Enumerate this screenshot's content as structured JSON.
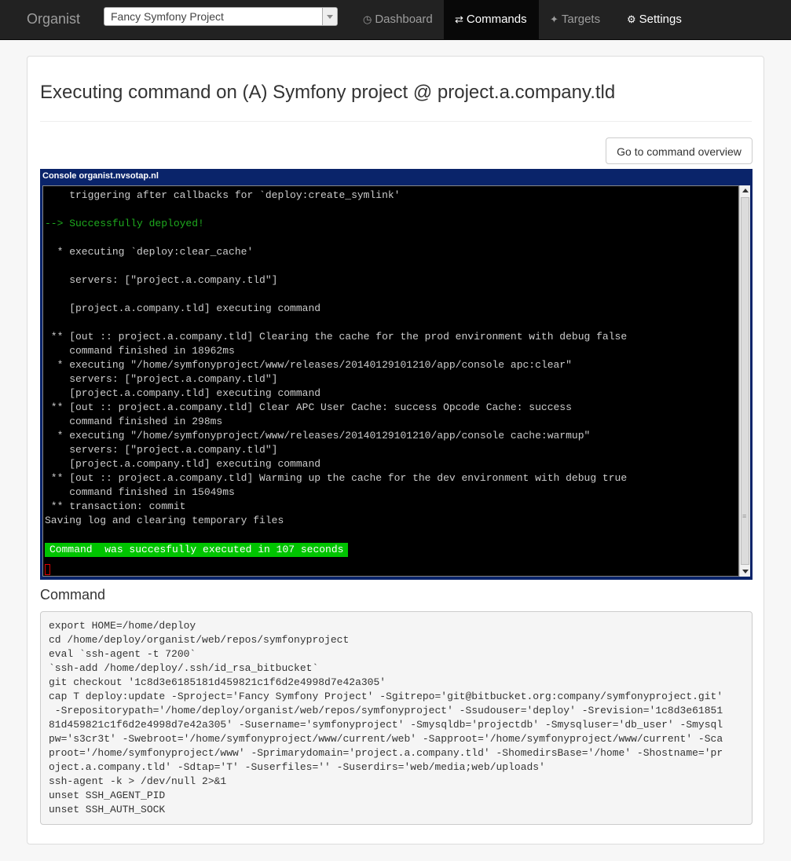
{
  "navbar": {
    "brand": "Organist",
    "project_select": "Fancy Symfony Project",
    "items": [
      {
        "label": "Dashboard",
        "icon": "dashboard-icon"
      },
      {
        "label": "Commands",
        "icon": "commands-icon"
      },
      {
        "label": "Targets",
        "icon": "targets-icon"
      },
      {
        "label": "Settings",
        "icon": "gear-icon"
      }
    ]
  },
  "page": {
    "title": "Executing command on (A) Symfony project @ project.a.company.tld",
    "overview_button": "Go to command overview"
  },
  "console": {
    "title": "Console organist.nvsotap.nl",
    "lines": [
      "    triggering after callbacks for `deploy:create_symlink'",
      "",
      "--> Successfully deployed!",
      "",
      "  * executing `deploy:clear_cache'",
      "",
      "    servers: [\"project.a.company.tld\"]",
      "",
      "    [project.a.company.tld] executing command",
      "",
      " ** [out :: project.a.company.tld] Clearing the cache for the prod environment with debug false",
      "    command finished in 18962ms",
      "  * executing \"/home/symfonyproject/www/releases/20140129101210/app/console apc:clear\"",
      "    servers: [\"project.a.company.tld\"]",
      "    [project.a.company.tld] executing command",
      " ** [out :: project.a.company.tld] Clear APC User Cache: success Opcode Cache: success",
      "    command finished in 298ms",
      "  * executing \"/home/symfonyproject/www/releases/20140129101210/app/console cache:warmup\"",
      "    servers: [\"project.a.company.tld\"]",
      "    [project.a.company.tld] executing command",
      " ** [out :: project.a.company.tld] Warming up the cache for the dev environment with debug true",
      "    command finished in 15049ms",
      " ** transaction: commit",
      "Saving log and clearing temporary files",
      "",
      "Command  was succesfully executed in 107 seconds"
    ],
    "success_color": "#00c400",
    "deployed_color": "#1eaa1e"
  },
  "command": {
    "heading": "Command",
    "lines": [
      "export HOME=/home/deploy",
      "cd /home/deploy/organist/web/repos/symfonyproject",
      "eval `ssh-agent -t 7200`",
      "`ssh-add /home/deploy/.ssh/id_rsa_bitbucket`",
      "git checkout '1c8d3e6185181d459821c1f6d2e4998d7e42a305'",
      "cap T deploy:update -Sproject='Fancy Symfony Project' -Sgitrepo='git@bitbucket.org:company/symfonyproject.git'",
      " -Srepositorypath='/home/deploy/organist/web/repos/symfonyproject' -Ssudouser='deploy' -Srevision='1c8d3e61851",
      "81d459821c1f6d2e4998d7e42a305' -Susername='symfonyproject' -Smysqldb='projectdb' -Smysqluser='db_user' -Smysql",
      "pw='s3cr3t' -Swebroot='/home/symfonyproject/www/current/web' -Sapproot='/home/symfonyproject/www/current' -Sca",
      "proot='/home/symfonyproject/www' -Sprimarydomain='project.a.company.tld' -ShomedirsBase='/home' -Shostname='pr",
      "oject.a.company.tld' -Sdtap='T' -Suserfiles='' -Suserdirs='web/media;web/uploads'",
      "ssh-agent -k > /dev/null 2>&1",
      "unset SSH_AGENT_PID",
      "unset SSH_AUTH_SOCK"
    ]
  }
}
